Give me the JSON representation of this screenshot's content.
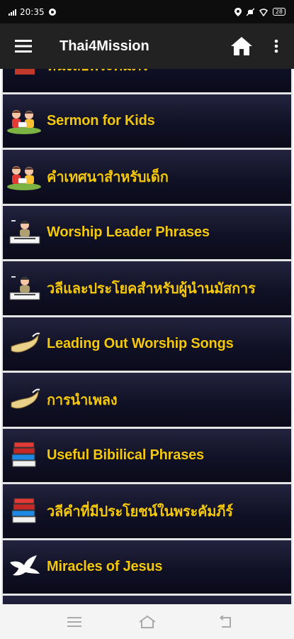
{
  "status_bar": {
    "time": "20:35",
    "battery": "28"
  },
  "app_bar": {
    "title": "Thai4Mission",
    "menu_icon": "hamburger-menu-icon",
    "home_icon": "home-icon",
    "more_icon": "more-vert-icon"
  },
  "list": {
    "items": [
      {
        "label": "หนังสือพระคัมภีร์",
        "icon": "bible-icon"
      },
      {
        "label": "Sermon for Kids",
        "icon": "kids-reading-icon"
      },
      {
        "label": "คำเทศนาสำหรับเด็ก",
        "icon": "kids-reading-icon"
      },
      {
        "label": "Worship Leader Phrases",
        "icon": "worship-leader-icon"
      },
      {
        "label": "วลีและประโยคสำหรับผู้นำนมัสการ",
        "icon": "worship-leader-icon"
      },
      {
        "label": "Leading Out Worship Songs",
        "icon": "shofar-horn-icon"
      },
      {
        "label": "การนำเพลง",
        "icon": "shofar-horn-icon"
      },
      {
        "label": "Useful Bibilical Phrases",
        "icon": "book-stack-icon"
      },
      {
        "label": "วลีคำที่มีประโยชน์ในพระคัมภีร์",
        "icon": "book-stack-icon"
      },
      {
        "label": "Miracles of Jesus",
        "icon": "dove-icon"
      },
      {
        "label": "",
        "icon": "dove-icon"
      }
    ]
  },
  "nav_bar": {
    "menu_icon": "recents-icon",
    "home_icon": "system-home-icon",
    "back_icon": "back-icon"
  },
  "colors": {
    "item_text": "#f3c80f",
    "item_bg": "#111126",
    "app_bar_bg": "#222222"
  }
}
